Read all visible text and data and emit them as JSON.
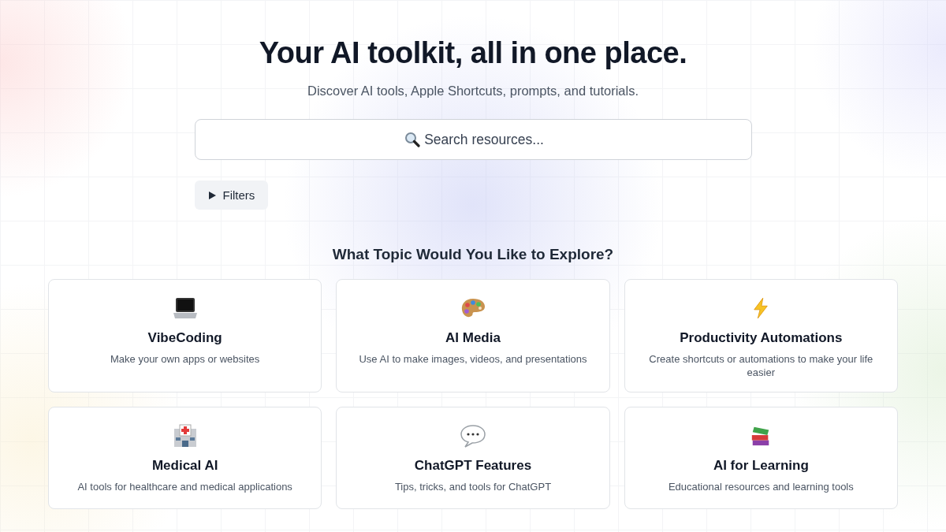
{
  "hero": {
    "title": "Your AI toolkit, all in one place.",
    "subtitle": "Discover AI tools, Apple Shortcuts, prompts, and tutorials."
  },
  "search": {
    "placeholder": "Search resources..."
  },
  "filters": {
    "label": "Filters",
    "expanded": false
  },
  "topics": {
    "heading": "What Topic Would You Like to Explore?",
    "cards": [
      {
        "kind": "laptop",
        "title": "VibeCoding",
        "description": "Make your own apps or websites"
      },
      {
        "kind": "palette",
        "title": "AI Media",
        "description": "Use AI to make images, videos, and presentations"
      },
      {
        "kind": "lightning",
        "title": "Productivity Automations",
        "description": "Create shortcuts or automations to make your life easier"
      },
      {
        "kind": "hospital",
        "title": "Medical AI",
        "description": "AI tools for healthcare and medical applications"
      },
      {
        "kind": "speech",
        "title": "ChatGPT Features",
        "description": "Tips, tricks, and tools for ChatGPT"
      },
      {
        "kind": "books",
        "title": "AI for Learning",
        "description": "Educational resources and learning tools"
      }
    ]
  }
}
